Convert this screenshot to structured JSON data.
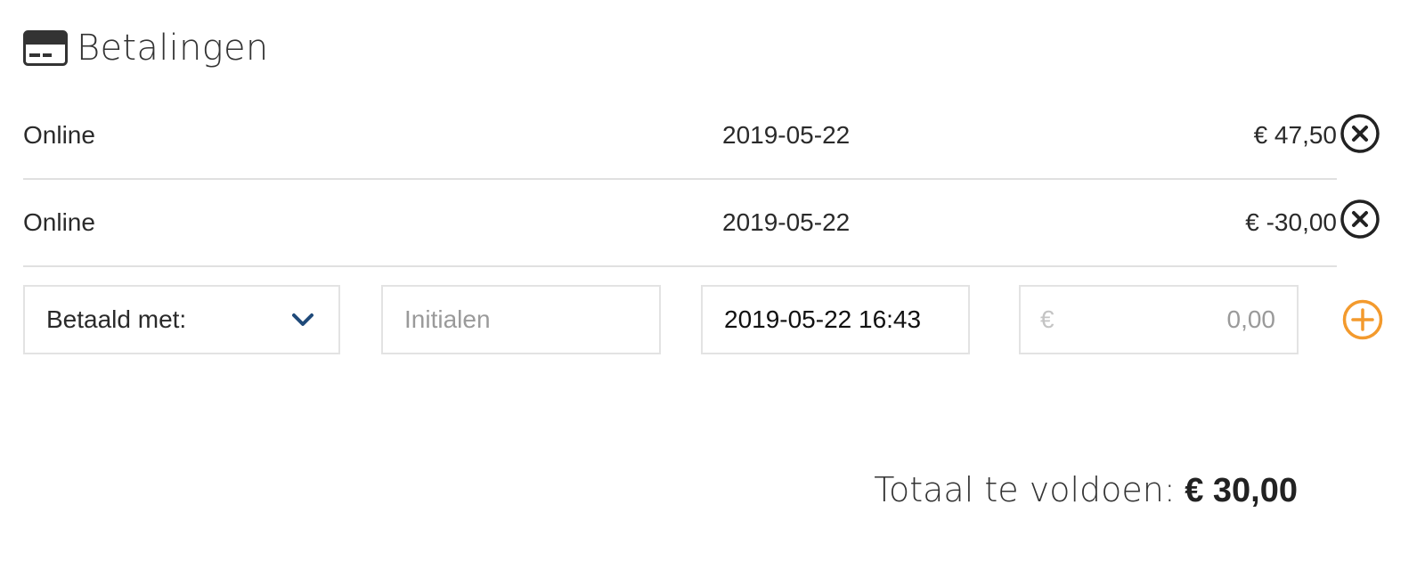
{
  "header": {
    "title": "Betalingen",
    "icon": "credit-card-icon"
  },
  "payments": [
    {
      "method": "Online",
      "date": "2019-05-22",
      "amount": "€ 47,50",
      "remove_icon": "close-circle-icon"
    },
    {
      "method": "Online",
      "date": "2019-05-22",
      "amount": "€ -30,00",
      "remove_icon": "close-circle-icon"
    }
  ],
  "form": {
    "method_select": {
      "label": "Betaald met:",
      "icon": "chevron-down-icon"
    },
    "initials": {
      "value": "",
      "placeholder": "Initialen"
    },
    "datetime": {
      "value": "2019-05-22 16:43",
      "placeholder": ""
    },
    "amount": {
      "currency": "€",
      "value": "",
      "placeholder": "0,00"
    },
    "add_icon": "plus-circle-icon"
  },
  "total": {
    "label": "Totaal te voldoen:",
    "value": "€ 30,00"
  },
  "colors": {
    "accent_orange": "#f39a2d",
    "chevron_blue": "#1f4a7a",
    "text": "#222222",
    "divider": "#e0e0e0",
    "border": "#e3e3e3"
  }
}
